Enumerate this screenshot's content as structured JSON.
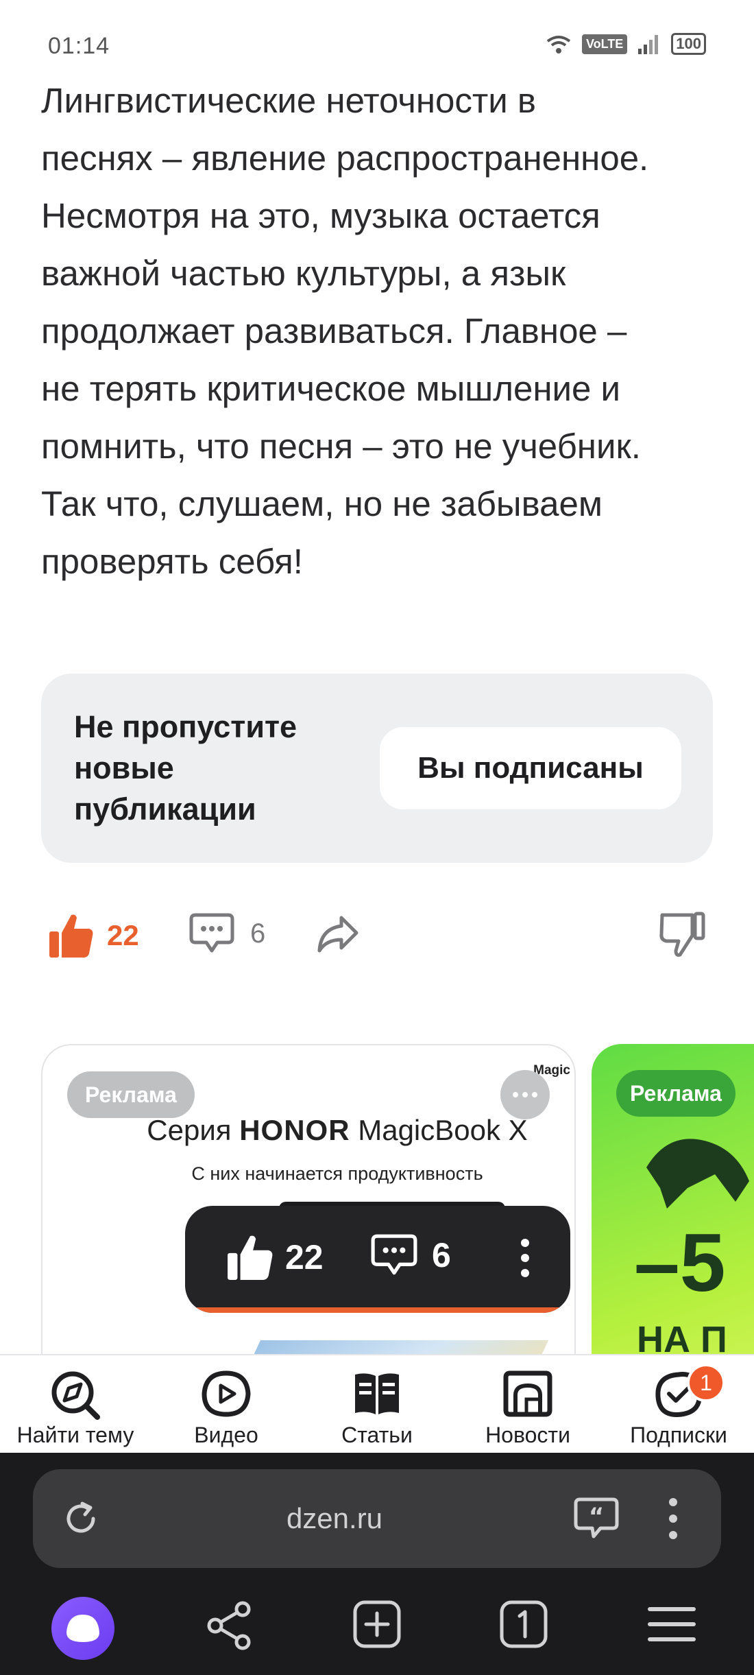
{
  "status_bar": {
    "time": "01:14",
    "volte": "VoLTE",
    "battery": "100"
  },
  "article": {
    "lines": [
      "Лингвистические неточности в",
      "песнях – явление распространенное.",
      "Несмотря на это, музыка остается",
      "важной частью культуры, а язык",
      "продолжает развиваться. Главное –",
      "не терять критическое мышление и",
      "помнить, что песня – это не учебник.",
      "Так что, слушаем, но не забываем",
      "проверять себя!"
    ]
  },
  "subscribe": {
    "lines": [
      "Не пропустите",
      "новые",
      "публикации"
    ],
    "button_label": "Вы подписаны"
  },
  "reactions": {
    "likes": "22",
    "comments": "6",
    "like_color": "#e9602f"
  },
  "ads": [
    {
      "badge": "Реклама",
      "brand_small": "Magic",
      "title_prefix": "Серия ",
      "title_brand": "HONOR",
      "title_suffix": " MagicBook X",
      "subtitle": "С них начинается продуктивность"
    },
    {
      "badge": "Реклама",
      "big_text": "–5",
      "small_text": "НА П"
    }
  ],
  "floating_bar": {
    "likes": "22",
    "comments": "6"
  },
  "tabs": [
    {
      "label": "Найти тему",
      "icon": "compass-search-icon"
    },
    {
      "label": "Видео",
      "icon": "video-play-icon"
    },
    {
      "label": "Статьи",
      "icon": "articles-book-icon"
    },
    {
      "label": "Новости",
      "icon": "news-icon"
    },
    {
      "label": "Подписки",
      "icon": "subscriptions-icon",
      "badge": "1"
    }
  ],
  "browser": {
    "url": "dzen.ru"
  }
}
